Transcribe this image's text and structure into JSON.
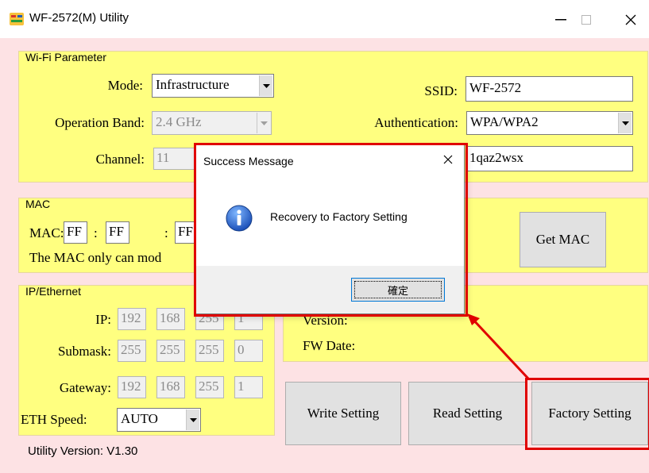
{
  "window": {
    "title": "WF-2572(M) Utility",
    "app_icon": "icp-das-logo-icon",
    "minimize_icon": "minimize-icon",
    "maximize_icon": "maximize-icon",
    "close_icon": "close-icon"
  },
  "wifi": {
    "legend": "Wi-Fi Parameter",
    "mode_label": "Mode:",
    "mode_value": "Infrastructure",
    "band_label": "Operation Band:",
    "band_value": "2.4 GHz",
    "channel_label": "Channel:",
    "channel_value": "11",
    "ssid_label": "SSID:",
    "ssid_value": "WF-2572",
    "auth_label": "Authentication:",
    "auth_value": "WPA/WPA2",
    "key_value": "1qaz2wsx"
  },
  "mac": {
    "legend": "MAC",
    "mac_label": "MAC:",
    "octet1": "FF",
    "octet2": "FF",
    "octet3": "FF",
    "sep": ":",
    "note": "The MAC only can mod",
    "get_mac_label": "Get MAC"
  },
  "ip": {
    "legend": "IP/Ethernet",
    "ip_label": "IP:",
    "ip": [
      "192",
      "168",
      "255",
      "1"
    ],
    "mask_label": "Submask:",
    "mask": [
      "255",
      "255",
      "255",
      "0"
    ],
    "gw_label": "Gateway:",
    "gw": [
      "192",
      "168",
      "255",
      "1"
    ],
    "speed_label": "ETH Speed:",
    "speed_value": "AUTO"
  },
  "fw": {
    "version_label": "Version:",
    "date_label": "FW Date:"
  },
  "buttons": {
    "write": "Write Setting",
    "read": "Read Setting",
    "factory": "Factory Setting"
  },
  "status": {
    "utility_version": "Utility Version: V1.30"
  },
  "dialog": {
    "title": "Success Message",
    "message": "Recovery to Factory Setting",
    "ok_label": "確定",
    "info_icon": "info-icon"
  },
  "colors": {
    "panel_yellow": "#ffff80",
    "background_pink": "#fde2e4",
    "highlight_red": "#e00000"
  }
}
